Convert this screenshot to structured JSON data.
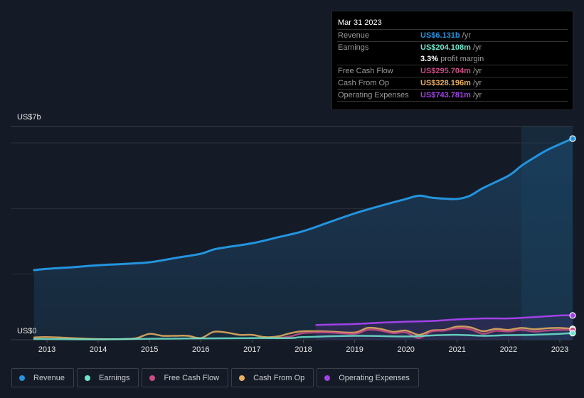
{
  "tooltip": {
    "date": "Mar 31 2023",
    "rows": [
      {
        "label": "Revenue",
        "value": "US$6.131b",
        "unit": "/yr",
        "color": "#2394df"
      },
      {
        "label": "Earnings",
        "value": "US$204.108m",
        "unit": "/yr",
        "color": "#6ee6cf"
      },
      {
        "label": "",
        "value": "3.3%",
        "unit": "profit margin",
        "color": "#ffffff"
      },
      {
        "label": "Free Cash Flow",
        "value": "US$295.704m",
        "unit": "/yr",
        "color": "#c94c86"
      },
      {
        "label": "Cash From Op",
        "value": "US$328.196m",
        "unit": "/yr",
        "color": "#e9b060"
      },
      {
        "label": "Operating Expenses",
        "value": "US$743.781m",
        "unit": "/yr",
        "color": "#a142e8"
      }
    ]
  },
  "chart_data": {
    "type": "area",
    "title": "",
    "xlabel": "",
    "ylabel": "",
    "y_top_label": "US$7b",
    "y_bottom_label": "US$0",
    "ylim": [
      0,
      7
    ],
    "xlim": [
      2012.25,
      2023.5
    ],
    "x_ticks": [
      "2013",
      "2014",
      "2015",
      "2016",
      "2017",
      "2018",
      "2019",
      "2020",
      "2021",
      "2022",
      "2023"
    ],
    "gridlines": [
      2,
      4,
      6
    ],
    "highlight_from": 2022.25,
    "series": [
      {
        "name": "Revenue",
        "color": "#2394df",
        "fill": true,
        "x": [
          2012.75,
          2013,
          2013.5,
          2014,
          2014.5,
          2015,
          2015.5,
          2016,
          2016.25,
          2016.5,
          2017,
          2017.5,
          2018,
          2018.5,
          2019,
          2019.5,
          2020,
          2020.25,
          2020.5,
          2020.75,
          2021,
          2021.25,
          2021.5,
          2022,
          2022.25,
          2022.5,
          2022.75,
          2023,
          2023.25
        ],
        "values": [
          2.12,
          2.16,
          2.21,
          2.27,
          2.31,
          2.36,
          2.49,
          2.62,
          2.75,
          2.82,
          2.94,
          3.12,
          3.31,
          3.58,
          3.85,
          4.08,
          4.29,
          4.39,
          4.33,
          4.3,
          4.29,
          4.39,
          4.62,
          5.0,
          5.3,
          5.55,
          5.78,
          5.96,
          6.13
        ]
      },
      {
        "name": "Earnings",
        "color": "#6ee6cf",
        "fill": false,
        "x": [
          2012.75,
          2013,
          2014,
          2015,
          2016,
          2017,
          2017.75,
          2018,
          2019,
          2020,
          2020.5,
          2021,
          2021.5,
          2022,
          2022.5,
          2023,
          2023.25
        ],
        "values": [
          0.02,
          0.02,
          0.01,
          0.03,
          0.04,
          0.05,
          0.05,
          0.08,
          0.12,
          0.1,
          0.13,
          0.15,
          0.12,
          0.14,
          0.15,
          0.18,
          0.2
        ]
      },
      {
        "name": "Free Cash Flow",
        "color": "#c94c86",
        "fill": false,
        "x": [
          2017.5,
          2017.75,
          2018,
          2018.5,
          2019,
          2019.25,
          2019.5,
          2019.75,
          2020,
          2020.25,
          2020.5,
          2020.75,
          2021,
          2021.25,
          2021.5,
          2021.75,
          2022,
          2022.25,
          2022.5,
          2022.75,
          2023,
          2023.25
        ],
        "values": [
          0.05,
          0.1,
          0.2,
          0.22,
          0.18,
          0.3,
          0.28,
          0.2,
          0.22,
          0.05,
          0.25,
          0.28,
          0.35,
          0.32,
          0.18,
          0.27,
          0.25,
          0.3,
          0.25,
          0.28,
          0.3,
          0.3
        ]
      },
      {
        "name": "Cash From Op",
        "color": "#e9b060",
        "fill": false,
        "x": [
          2012.75,
          2013,
          2013.5,
          2014,
          2014.5,
          2014.75,
          2015,
          2015.25,
          2015.5,
          2015.75,
          2016,
          2016.25,
          2016.5,
          2016.75,
          2017,
          2017.25,
          2017.5,
          2017.75,
          2018,
          2018.5,
          2019,
          2019.25,
          2019.5,
          2019.75,
          2020,
          2020.25,
          2020.5,
          2020.75,
          2021,
          2021.25,
          2021.5,
          2021.75,
          2022,
          2022.25,
          2022.5,
          2022.75,
          2023,
          2023.25
        ],
        "values": [
          0.07,
          0.08,
          0.05,
          0.02,
          0.02,
          0.05,
          0.18,
          0.12,
          0.12,
          0.12,
          0.05,
          0.24,
          0.22,
          0.15,
          0.15,
          0.08,
          0.1,
          0.2,
          0.26,
          0.25,
          0.22,
          0.36,
          0.33,
          0.24,
          0.28,
          0.15,
          0.28,
          0.3,
          0.4,
          0.38,
          0.26,
          0.33,
          0.3,
          0.36,
          0.32,
          0.35,
          0.36,
          0.33
        ]
      },
      {
        "name": "Operating Expenses",
        "color": "#a142e8",
        "fill": true,
        "x": [
          2018.25,
          2018.5,
          2019,
          2019.5,
          2020,
          2020.5,
          2021,
          2021.5,
          2022,
          2022.5,
          2023,
          2023.25
        ],
        "values": [
          0.45,
          0.46,
          0.48,
          0.52,
          0.55,
          0.57,
          0.62,
          0.65,
          0.65,
          0.69,
          0.74,
          0.74
        ]
      }
    ]
  },
  "legend": [
    {
      "label": "Revenue",
      "color": "#2394df"
    },
    {
      "label": "Earnings",
      "color": "#6ee6cf"
    },
    {
      "label": "Free Cash Flow",
      "color": "#c94c86"
    },
    {
      "label": "Cash From Op",
      "color": "#e9b060"
    },
    {
      "label": "Operating Expenses",
      "color": "#a142e8"
    }
  ]
}
